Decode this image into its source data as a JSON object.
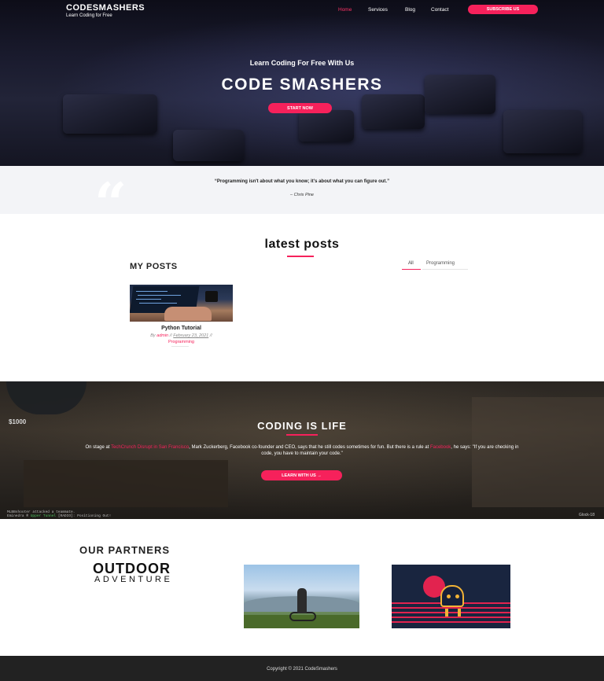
{
  "header": {
    "brand_title": "CODESMASHERS",
    "brand_tagline": "Learn Coding for Free",
    "nav": [
      {
        "label": "Home",
        "active": true
      },
      {
        "label": "Services",
        "active": false
      },
      {
        "label": "Blog",
        "active": false
      },
      {
        "label": "Contact",
        "active": false
      }
    ],
    "subscribe_label": "SUBSCRIBE US"
  },
  "hero": {
    "subtitle": "Learn Coding For Free With Us",
    "title": "CODE SMASHERS",
    "cta_label": "START NOW"
  },
  "quote": {
    "mark": "“",
    "text": "“Programming isn't about what you know; it's about what you can figure out.”",
    "author": "– Chris Pine"
  },
  "posts_section": {
    "title": "latest posts",
    "heading": "MY POSTS",
    "filters": [
      {
        "label": "All",
        "active": true
      },
      {
        "label": "Programming",
        "active": false
      }
    ],
    "post": {
      "title": "Python Tutorial",
      "by": "By",
      "author": "admin",
      "sep": "//",
      "date": "February 23, 2021",
      "category": "Programming"
    }
  },
  "life_section": {
    "money": "$1000",
    "title": "CODING IS LIFE",
    "text_parts": {
      "p1": "On stage at ",
      "link1": "TechCrunch Disrupt in San Francisco",
      "p2": ", Mark Zuckerberg, Facebook co-founder and CEO, says that he still codes sometimes for fun. But there is a rule at ",
      "link2": "Facebook",
      "p3": ", he says: \"If you are checking in code, you have to maintain your code.\""
    },
    "cta_label": "LEARN WITH US →",
    "killfeed_line1": "MLBBshooter attacked a teammate.",
    "killfeed_line2_a": "Eminedra ® ",
    "killfeed_line2_b": "Upper Tunnel",
    "killfeed_line2_c": " [RADIO]: Positioning Out!",
    "weapon_label": "Glock-18"
  },
  "partners": {
    "title": "OUR PARTNERS",
    "logo_line1": "OUTDOOR",
    "logo_line2": "ADVENTURE"
  },
  "footer": {
    "copyright": "Copyright © 2021 CodeSmashers"
  },
  "colors": {
    "accent": "#f6215b",
    "footer_bg": "#222222",
    "quote_bg": "#f3f4f7"
  }
}
